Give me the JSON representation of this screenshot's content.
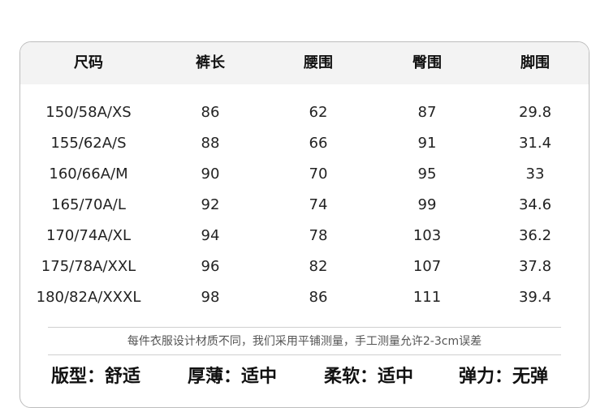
{
  "table": {
    "headers": [
      "尺码",
      "裤长",
      "腰围",
      "臀围",
      "脚围"
    ],
    "rows": [
      [
        "150/58A/XS",
        "86",
        "62",
        "87",
        "29.8"
      ],
      [
        "155/62A/S",
        "88",
        "66",
        "91",
        "31.4"
      ],
      [
        "160/66A/M",
        "90",
        "70",
        "95",
        "33"
      ],
      [
        "165/70A/L",
        "92",
        "74",
        "99",
        "34.6"
      ],
      [
        "170/74A/XL",
        "94",
        "78",
        "103",
        "36.2"
      ],
      [
        "175/78A/XXL",
        "96",
        "82",
        "107",
        "37.8"
      ],
      [
        "180/82A/XXXL",
        "98",
        "86",
        "111",
        "39.4"
      ]
    ]
  },
  "note": "每件衣服设计材质不同，我们采用平铺测量，手工测量允许2-3cm误差",
  "attributes": [
    {
      "label": "版型：",
      "value": "舒适"
    },
    {
      "label": "厚薄：",
      "value": "适中"
    },
    {
      "label": "柔软：",
      "value": "适中"
    },
    {
      "label": "弹力：",
      "value": "无弹"
    }
  ]
}
